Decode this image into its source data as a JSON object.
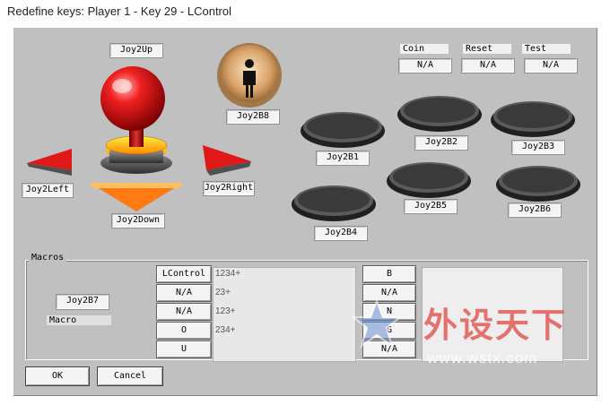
{
  "window": {
    "title": "Redefine keys: Player 1 - Key 29 - LControl"
  },
  "joystick": {
    "up": "Joy2Up",
    "down": "Joy2Down",
    "left": "Joy2Left",
    "right": "Joy2Right"
  },
  "special": {
    "player_button": "Joy2B8"
  },
  "system": {
    "coin_label": "Coin",
    "coin_value": "N/A",
    "reset_label": "Reset",
    "reset_value": "N/A",
    "test_label": "Test",
    "test_value": "N/A"
  },
  "buttons": [
    "Joy2B1",
    "Joy2B2",
    "Joy2B3",
    "Joy2B4",
    "Joy2B5",
    "Joy2B6"
  ],
  "macros": {
    "title": "Macros",
    "trigger": "Joy2B7",
    "macro_label": "Macro",
    "keys": [
      "LControl",
      "N/A",
      "N/A",
      "O",
      "U"
    ],
    "sequences": [
      "1234+",
      "23+",
      "123+",
      "234+"
    ],
    "outputs": [
      "B",
      "N/A",
      "N",
      "G",
      "N/A"
    ]
  },
  "dialog": {
    "ok": "OK",
    "cancel": "Cancel"
  },
  "watermark": {
    "text": "外设天下",
    "url": "www.wstx.com"
  },
  "colors": {
    "panel": "#c0c0c0",
    "ball": "#e0101a",
    "arrow": "#e01818",
    "down_arrow": "#ff7a10",
    "player_button": "#c8955a"
  }
}
